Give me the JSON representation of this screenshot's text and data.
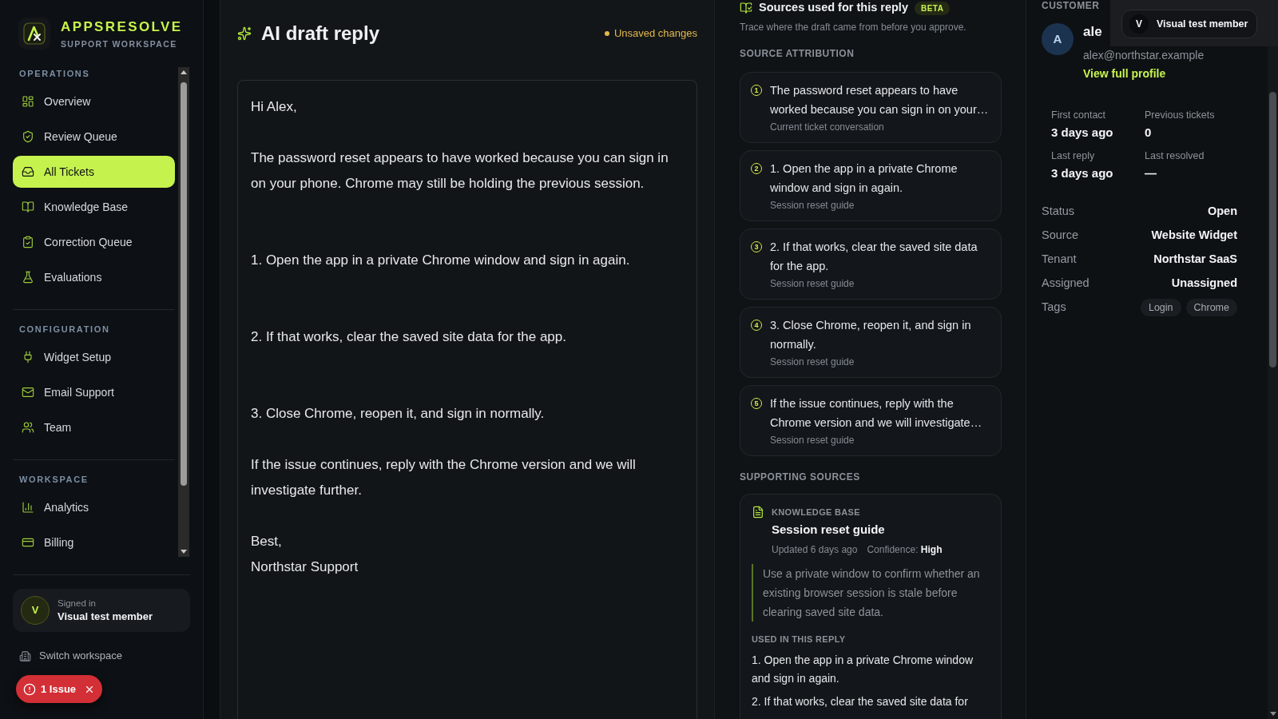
{
  "sidebar": {
    "brand": {
      "name": "APPSRESOLVE",
      "tagline": "SUPPORT WORKSPACE"
    },
    "sections": [
      {
        "label": "OPERATIONS",
        "items": [
          {
            "label": "Overview",
            "selected": false
          },
          {
            "label": "Review Queue",
            "selected": false
          },
          {
            "label": "All Tickets",
            "selected": true
          },
          {
            "label": "Knowledge Base",
            "selected": false
          },
          {
            "label": "Correction Queue",
            "selected": false
          },
          {
            "label": "Evaluations",
            "selected": false
          }
        ]
      },
      {
        "label": "CONFIGURATION",
        "items": [
          {
            "label": "Widget Setup",
            "selected": false
          },
          {
            "label": "Email Support",
            "selected": false
          },
          {
            "label": "Team",
            "selected": false
          }
        ]
      },
      {
        "label": "WORKSPACE",
        "items": [
          {
            "label": "Analytics",
            "selected": false
          },
          {
            "label": "Billing",
            "selected": false
          }
        ]
      }
    ],
    "user": {
      "initial": "V",
      "status": "Signed in",
      "name": "Visual test member"
    },
    "switch_workspace": "Switch workspace",
    "issue_badge": "1 Issue"
  },
  "editor": {
    "title": "AI draft reply",
    "status": "Unsaved changes",
    "draft": {
      "value": "Hi Alex,\n\nThe password reset appears to have worked because you can sign in on your phone. Chrome may still be holding the previous session.\n\n\n1. Open the app in a private Chrome window and sign in again.\n\n\n2. If that works, clear the saved site data for the app.\n\n\n3. Close Chrome, reopen it, and sign in normally.\n\nIf the issue continues, reply with the Chrome version and we will investigate further.\n\nBest,\nNorthstar Support"
    }
  },
  "sources": {
    "title": "Sources used for this reply",
    "badge": "BETA",
    "subtitle": "Trace where the draft came from before you approve.",
    "attribution": {
      "heading": "SOURCE ATTRIBUTION",
      "items": [
        {
          "number": "1",
          "text": "The password reset appears to have worked because you can sign in on your…",
          "source": "Current ticket conversation"
        },
        {
          "number": "2",
          "text": "1. Open the app in a private Chrome window and sign in again.",
          "source": "Session reset guide"
        },
        {
          "number": "3",
          "text": "2. If that works, clear the saved site data for the app.",
          "source": "Session reset guide"
        },
        {
          "number": "4",
          "text": "3. Close Chrome, reopen it, and sign in normally.",
          "source": "Session reset guide"
        },
        {
          "number": "5",
          "text": "If the issue continues, reply with the Chrome version and we will investigate…",
          "source": "Session reset guide"
        }
      ]
    },
    "supporting": {
      "heading": "SUPPORTING SOURCES",
      "items": [
        {
          "category": "KNOWLEDGE BASE",
          "title": "Session reset guide",
          "updated": "Updated 6 days ago",
          "confidence": "Confidence: **High**",
          "excerpt": "Use a private window to confirm whether an existing browser session is stale before clearing saved site data.",
          "used_heading": "USED IN THIS REPLY",
          "used_items": [
            "1. Open the app in a private Chrome window and sign in again.",
            "2. If that works, clear the saved site data for"
          ]
        }
      ]
    }
  },
  "customer": {
    "heading": "CUSTOMER",
    "initial": "A",
    "name": "ale",
    "email": "alex@northstar.example",
    "profile_link": "View full profile",
    "stats": [
      {
        "label": "First contact",
        "value": "3 days ago"
      },
      {
        "label": "Previous tickets",
        "value": "0"
      },
      {
        "label": "Last reply",
        "value": "3 days ago"
      },
      {
        "label": "Last resolved",
        "value": "—"
      }
    ],
    "details": [
      {
        "label": "Status",
        "value": "Open"
      },
      {
        "label": "Source",
        "value": "Website Widget"
      },
      {
        "label": "Tenant",
        "value": "Northstar SaaS"
      },
      {
        "label": "Assigned",
        "value": "Unassigned"
      }
    ],
    "tags": {
      "label": "Tags",
      "items": [
        "Login",
        "Chrome"
      ]
    }
  },
  "overlay": {
    "initial": "V",
    "name": "Visual test member"
  }
}
